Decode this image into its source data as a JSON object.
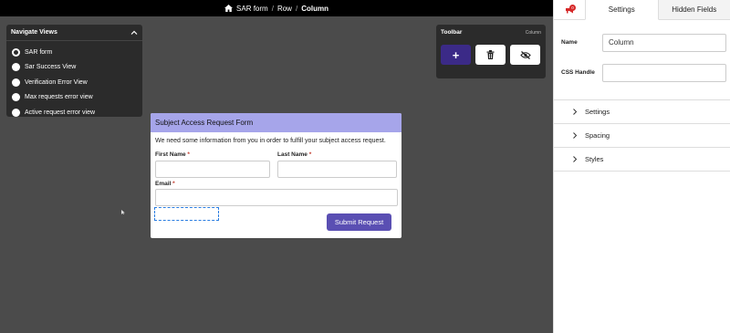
{
  "breadcrumb": {
    "items": [
      "SAR form",
      "Row",
      "Column"
    ],
    "separator": "/"
  },
  "navigate": {
    "title": "Navigate Views",
    "views": [
      {
        "label": "SAR form",
        "selected": true
      },
      {
        "label": "Sar Success View",
        "selected": false
      },
      {
        "label": "Verification Error View",
        "selected": false
      },
      {
        "label": "Max requests error view",
        "selected": false
      },
      {
        "label": "Active request error view",
        "selected": false
      }
    ]
  },
  "toolbar": {
    "title": "Toolbar",
    "context": "Column",
    "add_label": "+"
  },
  "form": {
    "title": "Subject Access Request Form",
    "intro": "We need some information from you in order to fulfill your subject access request.",
    "first_name_label": "First Name",
    "last_name_label": "Last Name",
    "email_label": "Email",
    "required_mark": "*",
    "submit_label": "Submit Request"
  },
  "settings": {
    "badge_count": "0",
    "tabs": [
      "Settings",
      "Hidden Fields"
    ],
    "name_label": "Name",
    "name_value": "Column",
    "css_label": "CSS Handle",
    "css_value": "",
    "sections": [
      "Settings",
      "Spacing",
      "Styles"
    ]
  },
  "colors": {
    "accent": "#3b2a87",
    "form_header": "#a6a5ea",
    "submit": "#5a4fb3",
    "badge": "#d62828"
  }
}
